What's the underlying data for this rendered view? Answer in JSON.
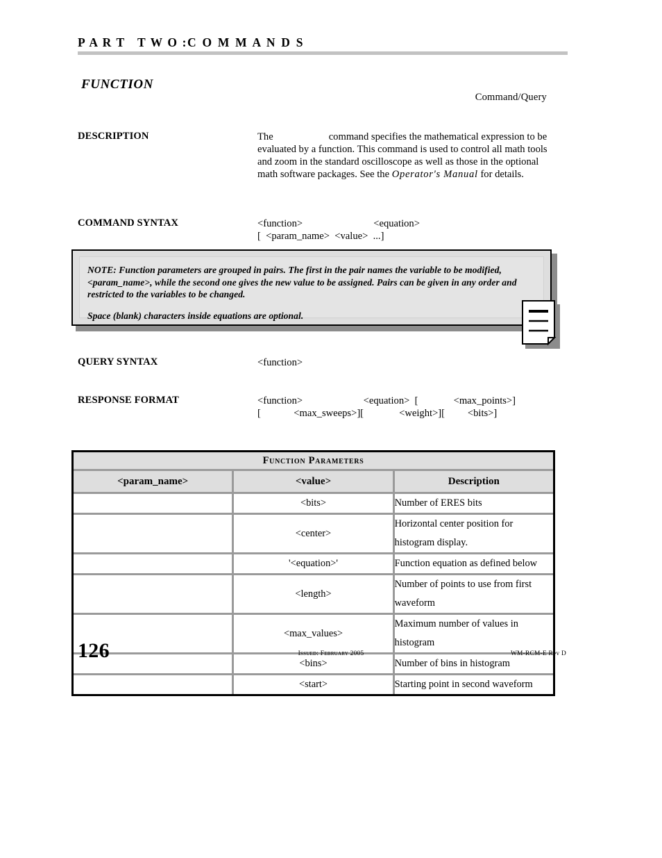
{
  "header": {
    "part_label": "P A R T   T W O :",
    "section_label": "C O M M A N D S"
  },
  "command": {
    "title": "FUNCTION",
    "kind": "Command/Query"
  },
  "sections": {
    "description": {
      "label": "DESCRIPTION",
      "text_before_gap": "The",
      "text_after_gap": "command specifies the mathematical expression to be evaluated by a function. This command is used to control all math tools and zoom in the standard oscilloscope as well as those in the optional math software packages. See the",
      "manual_ref": "Operator's Manual",
      "text_tail": "for details."
    },
    "command_syntax": {
      "label": "COMMAND SYNTAX",
      "line1": "<function>                            <equation>",
      "line2": "[  <param_name>  <value>  ...]"
    },
    "query_syntax": {
      "label": "QUERY SYNTAX",
      "line1": "<function>"
    },
    "response_format": {
      "label": "RESPONSE FORMAT",
      "line1": "<function>                        <equation>  [              <max_points>]",
      "line2": "[             <max_sweeps>][              <weight>][         <bits>]"
    }
  },
  "note": {
    "paragraph1": "NOTE: Function parameters are grouped in pairs. The first in the pair names the variable to be modified, <param_name>, while the second one gives the new value to be assigned. Pairs can be given in any order and restricted to the variables to be changed.",
    "paragraph2": "Space (blank) characters inside equations are optional."
  },
  "table": {
    "title": "Function Parameters",
    "columns": [
      "<param_name>",
      "<value>",
      "Description"
    ],
    "rows": [
      {
        "param_name": "",
        "value": "<bits>",
        "description": "Number of ERES bits"
      },
      {
        "param_name": "",
        "value": "<center>",
        "description": "Horizontal center position for histogram display."
      },
      {
        "param_name": "",
        "value": "'<equation>'",
        "description": "Function equation as defined below"
      },
      {
        "param_name": "",
        "value": "<length>",
        "description": "Number of points to use from first waveform"
      },
      {
        "param_name": "",
        "value": "<max_values>",
        "description": "Maximum number of values in histogram"
      },
      {
        "param_name": "",
        "value": "<bins>",
        "description": "Number of bins in histogram"
      },
      {
        "param_name": "",
        "value": "<start>",
        "description": "Starting point in second waveform"
      }
    ]
  },
  "footer": {
    "page_number": "126",
    "issued": "Issued: February 2005",
    "doc_ref": "WM-RCM-E Rev D"
  },
  "colors": {
    "header_rule": "#c2c2c2",
    "panel_fill": "#dedede",
    "table_border": "#000000",
    "cell_border": "#9a9a9a",
    "shadow": "#8c8c8c"
  }
}
